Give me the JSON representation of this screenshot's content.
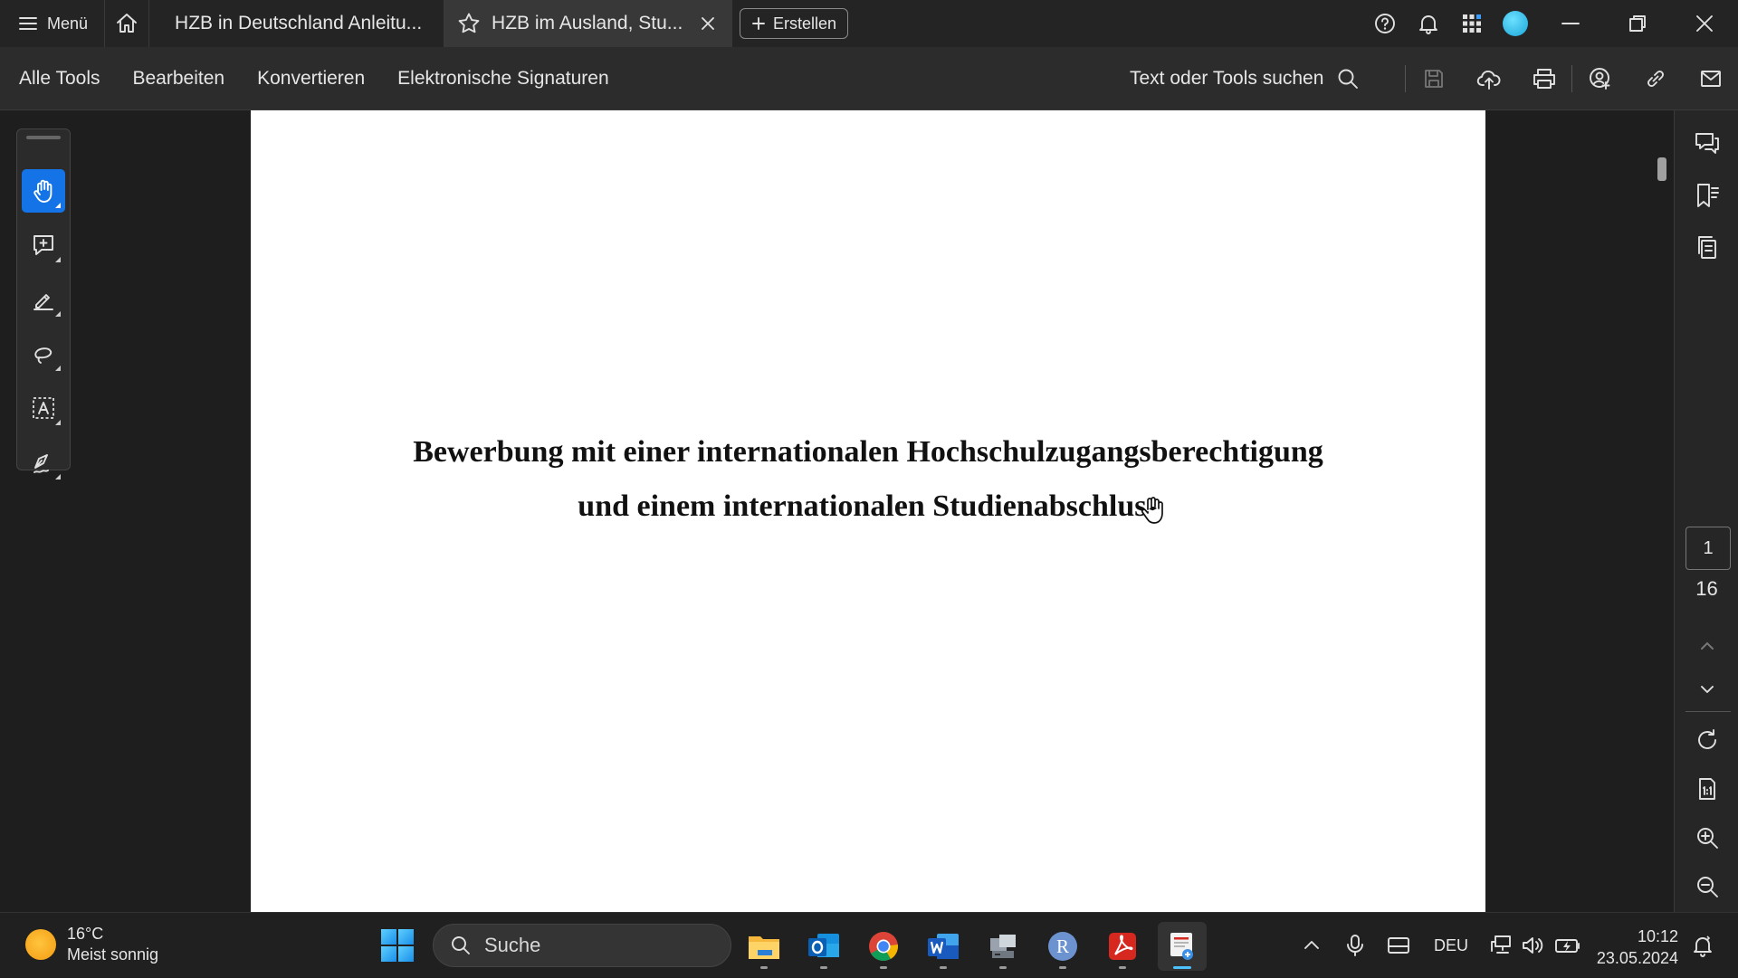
{
  "titlebar": {
    "menu_label": "Menü",
    "tabs": [
      {
        "label": "HZB in Deutschland Anleitu...",
        "active": false
      },
      {
        "label": "HZB im Ausland, Stu...",
        "active": true
      }
    ],
    "create_label": "Erstellen"
  },
  "toolbar": {
    "menu_items": [
      "Alle Tools",
      "Bearbeiten",
      "Konvertieren",
      "Elektronische Signaturen"
    ],
    "search_label": "Text oder Tools suchen"
  },
  "document": {
    "title_line1": "Bewerbung mit einer internationalen Hochschulzugangsberechtigung",
    "title_line2": "und einem internationalen Studienabschluss"
  },
  "page_nav": {
    "current_page": "1",
    "total_pages": "16"
  },
  "taskbar": {
    "weather_temp": "16°C",
    "weather_desc": "Meist sonnig",
    "search_placeholder": "Suche",
    "language": "DEU",
    "time": "10:12",
    "date": "23.05.2024"
  },
  "colors": {
    "accent": "#1473e6",
    "window_bg": "#1e1e1e",
    "toolbar_bg": "#2c2c2c",
    "page_bg": "#ffffff"
  }
}
